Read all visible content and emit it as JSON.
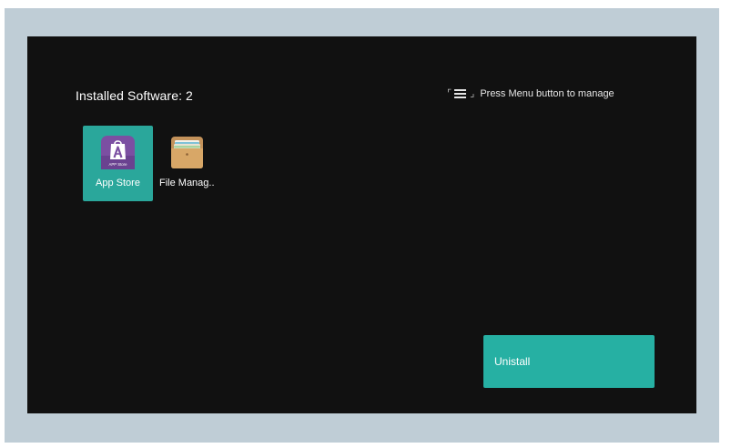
{
  "header": {
    "installed_label": "Installed Software: 2",
    "menu_hint": "Press Menu button to manage"
  },
  "apps": [
    {
      "label": "App Store",
      "icon": "app-store-icon",
      "focused": true,
      "icon_caption": "APP Store"
    },
    {
      "label": "File Manag..",
      "icon": "folder-icon",
      "focused": false
    }
  ],
  "actions": {
    "uninstall_label": "Unistall"
  },
  "colors": {
    "background_outer": "#bfcdd6",
    "screen": "#111111",
    "accent": "#26b0a3",
    "focused_tile": "#2aa79b",
    "app_store_icon": "#7b4fa2",
    "folder_icon": "#c99a5b"
  }
}
